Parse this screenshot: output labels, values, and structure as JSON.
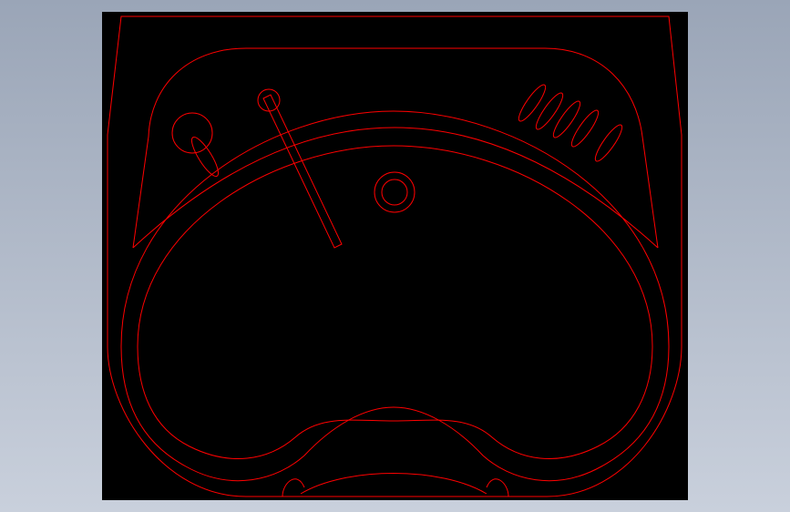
{
  "colors": {
    "background_top": "#9aa5b7",
    "background_bottom": "#c9d0dc",
    "viewport": "#000000",
    "line": "#ff0000"
  },
  "icons": {
    "cad_part": "sink-outline-drawing"
  }
}
